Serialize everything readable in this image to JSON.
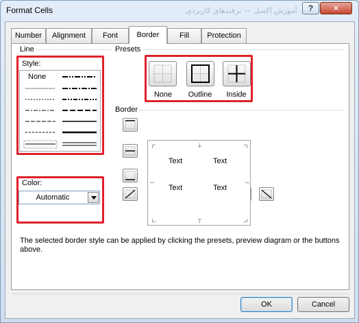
{
  "window": {
    "title": "Format Cells",
    "watermark": "آموزش اکسل — ترفندهای کاربردی",
    "help_glyph": "?",
    "close_glyph": "✕"
  },
  "tabs": [
    {
      "label": "Number"
    },
    {
      "label": "Alignment"
    },
    {
      "label": "Font"
    },
    {
      "label": "Border",
      "active": true
    },
    {
      "label": "Fill"
    },
    {
      "label": "Protection"
    }
  ],
  "line": {
    "group_label": "Line",
    "style_label": "Style:",
    "style_none": "None",
    "color_label": "Color:",
    "color_value": "Automatic"
  },
  "presets": {
    "group_label": "Presets",
    "items": [
      {
        "label": "None"
      },
      {
        "label": "Outline"
      },
      {
        "label": "Inside"
      }
    ]
  },
  "border": {
    "group_label": "Border",
    "preview_texts": [
      "Text",
      "Text",
      "Text",
      "Text"
    ]
  },
  "description": "The selected border style can be applied by clicking the presets, preview diagram or the buttons above.",
  "buttons": {
    "ok": "OK",
    "cancel": "Cancel"
  },
  "colors": {
    "highlight": "#e0202a",
    "close_button": "#c5482f"
  }
}
